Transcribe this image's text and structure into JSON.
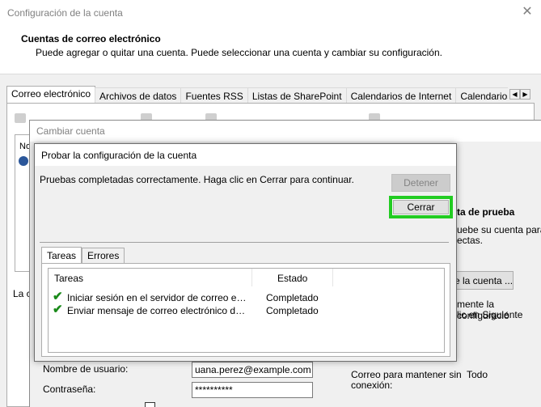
{
  "outer_window": {
    "title": "Configuración de la cuenta",
    "close_glyph": "✕",
    "header_title": "Cuentas de correo electrónico",
    "header_subtitle": "Puede agregar o quitar una cuenta. Puede seleccionar una cuenta y cambiar su configuración.",
    "tabs": [
      "Correo electrónico",
      "Archivos de datos",
      "Fuentes RSS",
      "Listas de SharePoint",
      "Calendarios de Internet",
      "Calendarios publ"
    ],
    "tab_scroll_left": "◀",
    "tab_scroll_right": "▶",
    "account_list_partial": "No",
    "bottom_partial_label": "La c"
  },
  "change_account_window": {
    "title": "Cambiar cuenta",
    "test_heading_partial": "ta de prueba",
    "test_desc_line1": "uebe su cuenta para",
    "test_desc_line2": "ectas.",
    "test_button_partial": "e la cuenta ...",
    "next_desc_line1": "mente la configuració",
    "next_desc_line2": "lic en Siguiente",
    "username_label": "Nombre de usuario:",
    "username_value": "uana.perez@example.com",
    "password_label": "Contraseña:",
    "password_value": "**********",
    "offline_label_line1": "Correo para mantener sin",
    "offline_label_line2": "conexión:",
    "offline_value": "Todo"
  },
  "test_dialog": {
    "title": "Probar la configuración de la cuenta",
    "message": "Pruebas completadas correctamente. Haga clic en Cerrar para continuar.",
    "stop_button": "Detener",
    "close_button": "Cerrar",
    "tabs": [
      "Tareas",
      "Errores"
    ],
    "columns": [
      "Tareas",
      "Estado"
    ],
    "rows": [
      {
        "task": "Iniciar sesión en el servidor de correo entrante (IMAP)",
        "status": "Completado"
      },
      {
        "task": "Enviar mensaje de correo electrónico de prueba",
        "status": "Completado"
      }
    ],
    "check_glyph": "✔"
  },
  "colors": {
    "highlight": "#22cc22",
    "check": "#1a8a1a"
  }
}
